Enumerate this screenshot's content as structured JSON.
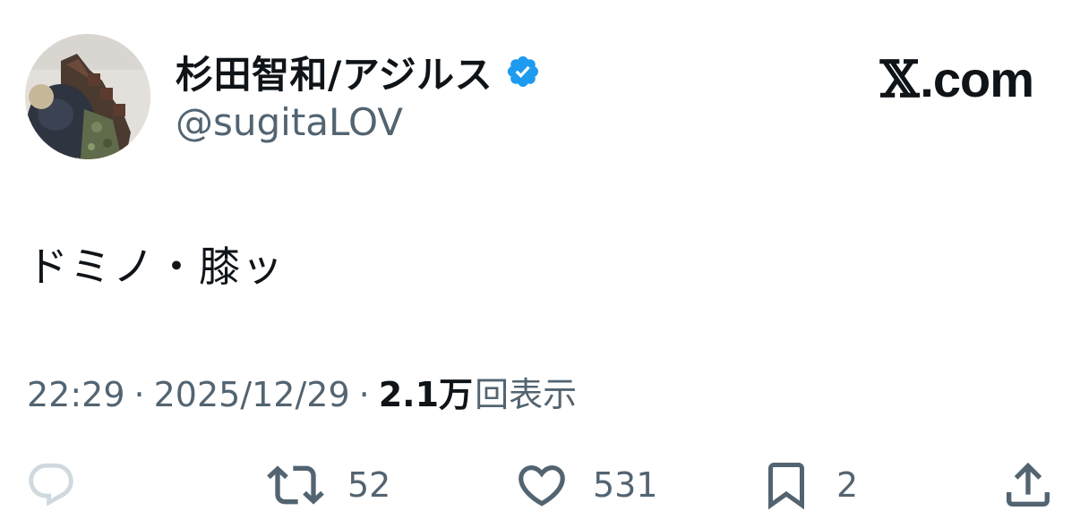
{
  "user": {
    "display_name": "杉田智和/アジルス",
    "handle": "@sugitaLOV",
    "verified": true,
    "avatar_icon": "profile-photo"
  },
  "brand": {
    "x_glyph": "𝕏",
    "domain": ".com"
  },
  "tweet": {
    "text": "ドミノ・膝ッ"
  },
  "meta": {
    "time": "22:29",
    "separator": "·",
    "date": "2025/12/29",
    "views_count": "2.1万",
    "views_label": "回表示"
  },
  "actions": {
    "reply": {
      "icon": "reply-icon",
      "count": ""
    },
    "retweet": {
      "icon": "retweet-icon",
      "count": "52"
    },
    "like": {
      "icon": "heart-icon",
      "count": "531"
    },
    "bookmark": {
      "icon": "bookmark-icon",
      "count": "2"
    },
    "share": {
      "icon": "share-icon",
      "count": ""
    }
  },
  "colors": {
    "text_primary": "#0f1419",
    "text_secondary": "#536471",
    "verified_blue": "#1d9bf0",
    "reply_icon_gray": "#cfd9de"
  }
}
